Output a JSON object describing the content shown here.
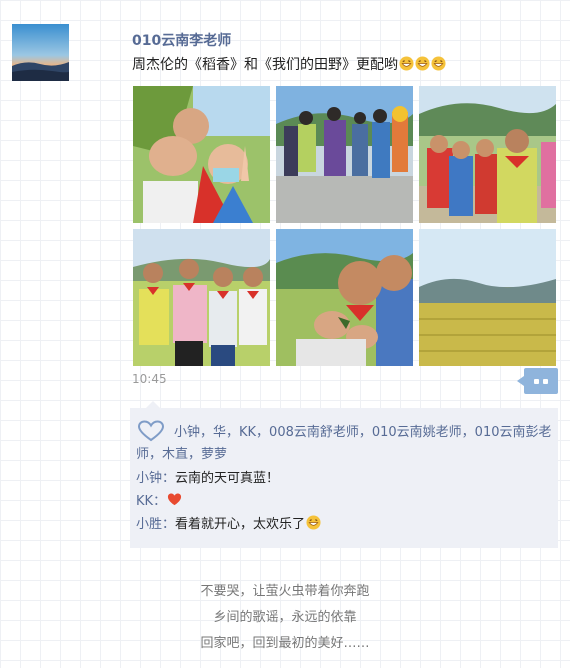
{
  "post": {
    "author": "010云南李老师",
    "text": "周杰伦的《稻香》和《我们的田野》更配哟",
    "emoji_icon": "grinning-face-icon",
    "time": "10:45"
  },
  "photos": [
    {
      "scene": "children-selfie-rice-field"
    },
    {
      "scene": "children-running-on-road"
    },
    {
      "scene": "children-group-red-scarves"
    },
    {
      "scene": "four-girls-in-rice-field"
    },
    {
      "scene": "boys-holding-insect"
    },
    {
      "scene": "golden-rice-field-landscape"
    }
  ],
  "likes": {
    "icon": "heart-outline-icon",
    "names": "小钟，华，KK，008云南舒老师，010云南姚老师，010云南彭老师，木直，萝萝"
  },
  "comments": [
    {
      "author": "小钟",
      "sep": "：",
      "text": "云南的天可真蓝！",
      "icon": ""
    },
    {
      "author": "KK",
      "sep": "：",
      "text": "",
      "icon": "red-heart-icon"
    },
    {
      "author": "小胜",
      "sep": "：",
      "text": "看着就开心，太欢乐了",
      "icon": "grinning-face-icon"
    }
  ],
  "lyrics": [
    "不要哭，让萤火虫带着你奔跑",
    "乡间的歌谣，永远的依靠",
    "回家吧，回到最初的美好……"
  ],
  "colors": {
    "link": "#576b95",
    "comment_bg": "#eef0f6",
    "more_button": "#8fb4dc",
    "heart": "#e84a30"
  }
}
